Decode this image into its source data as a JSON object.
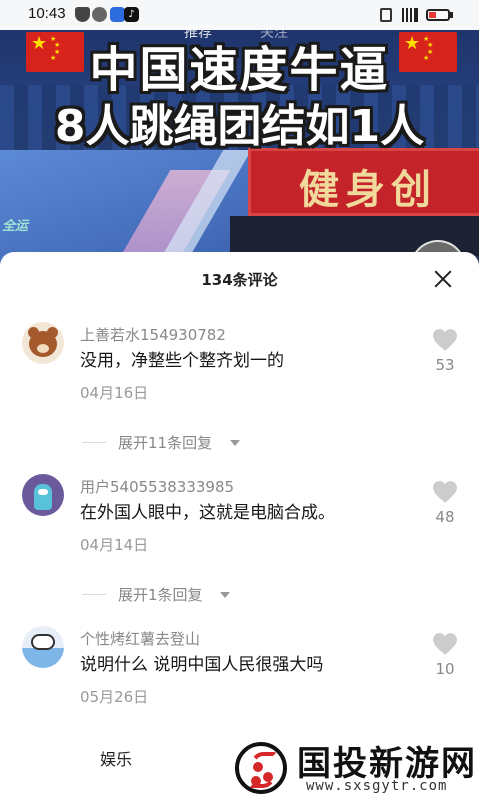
{
  "status_bar": {
    "time": "10:43"
  },
  "video": {
    "headline_1": "中国速度牛逼",
    "headline_2": "8人跳绳团结如1人",
    "banner_text": "健身创",
    "corner_logo": "全运",
    "top_tabs": [
      "推荐",
      "关注"
    ]
  },
  "comments_panel": {
    "title": "134条评论",
    "comments": [
      {
        "user": "上善若水154930782",
        "text": "没用，净整些个整齐划一的",
        "date": "04月16日",
        "likes": "53",
        "expand": "展开11条回复"
      },
      {
        "user": "用户5405538333985",
        "text": "在外国人眼中，这就是电脑合成。",
        "date": "04月14日",
        "likes": "48",
        "expand": "展开1条回复"
      },
      {
        "user": "个性烤红薯去登山",
        "text": "说明什么 说明中国人民很强大吗",
        "date": "05月26日",
        "likes": "10"
      }
    ]
  },
  "bottom_nav": {
    "tab_label": "娱乐"
  },
  "watermark": {
    "title": "国投新游网",
    "url": "www.sxsgytr.com"
  },
  "colors": {
    "flag_red": "#d6241d",
    "flag_star": "#ffde00",
    "banner_red": "#c4232a",
    "like_gray": "#cccccc"
  }
}
